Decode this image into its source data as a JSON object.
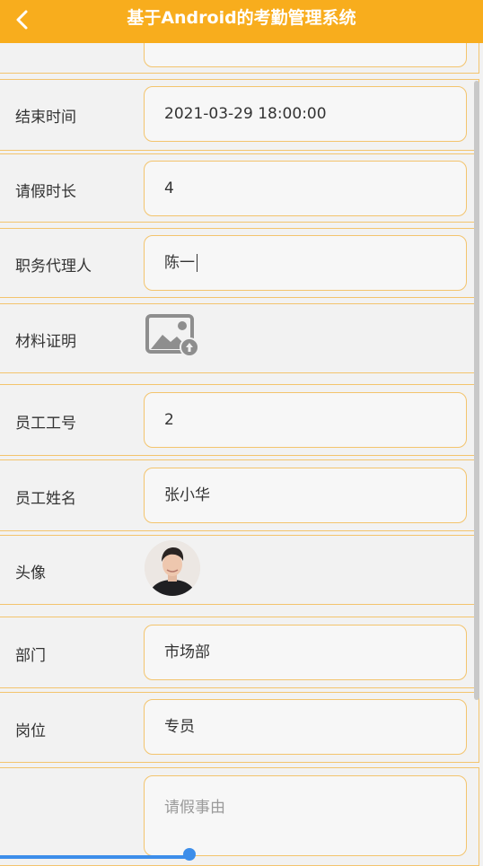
{
  "header": {
    "title": "基于Android的考勤管理系统",
    "back_icon": "chevron-left-icon",
    "color": "#f8ad1d"
  },
  "form": {
    "end_time": {
      "label": "结束时间",
      "value": "2021-03-29 18:00:00"
    },
    "leave_duration": {
      "label": "请假时长",
      "value": "4"
    },
    "proxy": {
      "label": "职务代理人",
      "value": "陈一"
    },
    "material": {
      "label": "材料证明",
      "icon": "image-upload-icon"
    },
    "employee_no": {
      "label": "员工工号",
      "value": "2"
    },
    "employee_name": {
      "label": "员工姓名",
      "value": "张小华"
    },
    "avatar": {
      "label": "头像"
    },
    "department": {
      "label": "部门",
      "value": "市场部"
    },
    "position": {
      "label": "岗位",
      "value": "专员"
    },
    "reason": {
      "label": "",
      "placeholder": "请假事由"
    }
  }
}
